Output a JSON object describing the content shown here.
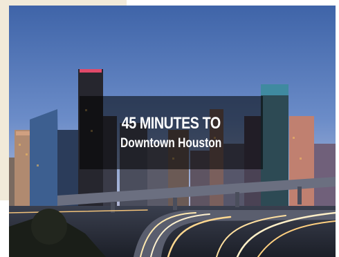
{
  "banner": {
    "headline": "45 MINUTES TO",
    "subline": "Downtown Houston"
  },
  "colors": {
    "page_accent": "#f1ead9",
    "caption_overlay": "#000000",
    "caption_text": "#ffffff"
  },
  "image": {
    "subject": "houston-skyline-highway-photo"
  }
}
